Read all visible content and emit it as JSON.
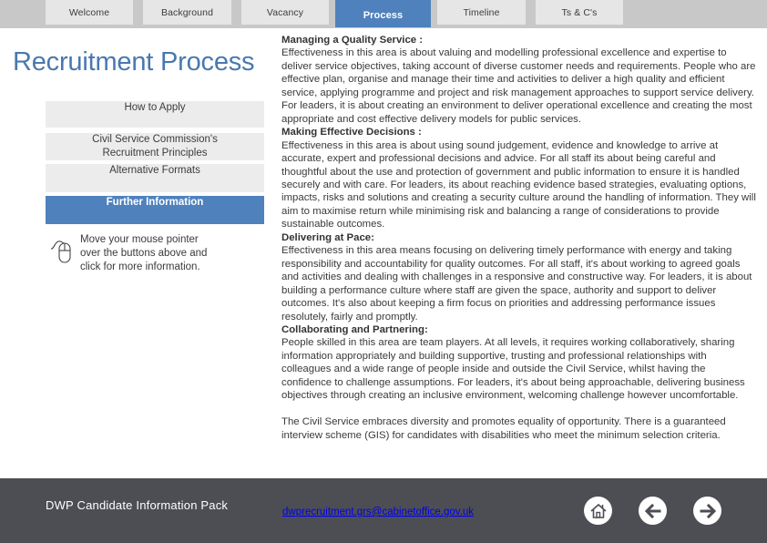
{
  "nav": {
    "tabs": [
      {
        "label": "Welcome",
        "active": false
      },
      {
        "label": "Background",
        "active": false
      },
      {
        "label": "Vacancy",
        "active": false
      },
      {
        "label": "Process",
        "active": true
      },
      {
        "label": "Timeline",
        "active": false
      },
      {
        "label": "Ts & C's",
        "active": false
      }
    ]
  },
  "page": {
    "title": "Recruitment Process"
  },
  "sidebar": {
    "buttons": [
      {
        "label": "How to Apply",
        "active": false
      },
      {
        "label": "Civil Service Commission's Recruitment Principles",
        "line1": "Civil Service Commission's",
        "line2": "Recruitment Principles",
        "active": false
      },
      {
        "label": "Alternative Formats",
        "active": false
      },
      {
        "label": "Further Information",
        "active": true
      }
    ],
    "hint": {
      "icon": "mouse-icon",
      "text": "Move your mouse pointer over the buttons above and click for more information.",
      "line1": "Move your mouse pointer",
      "line2": "over the buttons above and",
      "line3": "click for more information."
    }
  },
  "content": {
    "sections": [
      {
        "heading": "Managing a Quality Service :",
        "body": "Effectiveness in this area is about valuing and modelling professional excellence and expertise to deliver service objectives, taking account of diverse customer needs and requirements. People who are effective plan, organise and manage their time and activities to deliver a high quality and efficient service, applying programme and project and risk management approaches to support service delivery. For leaders, it is about creating an environment to deliver operational excellence and creating the most appropriate and cost effective delivery models for public services."
      },
      {
        "heading": "Making Effective Decisions :",
        "body": "Effectiveness in this area is about using sound judgement, evidence and knowledge to arrive at accurate, expert and professional decisions and advice. For all staff its about being careful and thoughtful about the use and protection of government and public information to ensure it is handled securely and with care. For leaders, its about reaching evidence based strategies, evaluating options, impacts, risks and solutions and creating a security culture around the handling of information. They will aim to maximise return while minimising risk and balancing a range of considerations to provide sustainable outcomes."
      },
      {
        "heading": "Delivering at Pace:",
        "body": "Effectiveness in this area means focusing on delivering timely performance with energy and taking responsibility and accountability for quality outcomes. For all staff, it's about working to agreed goals and activities and dealing with challenges in a responsive and constructive way. For leaders, it is about building a performance culture where staff are given the space, authority and support to deliver outcomes. It's also about keeping a firm focus on priorities and addressing performance issues resolutely, fairly and promptly."
      },
      {
        "heading": "Collaborating and Partnering:",
        "body": "People skilled in this area are team players. At all levels, it requires working collaboratively, sharing information appropriately and building supportive, trusting and professional relationships with colleagues and a wide range of people inside and outside the Civil Service, whilst having the confidence to challenge assumptions. For leaders, it's about being approachable, delivering business objectives through creating an inclusive environment, welcoming challenge however uncomfortable."
      }
    ],
    "closing": "The Civil Service embraces diversity and promotes equality of opportunity. There is a guaranteed interview scheme (GIS) for candidates with disabilities who meet the minimum selection criteria."
  },
  "footer": {
    "title": "DWP Candidate Information Pack",
    "email": "dwprecruitment.grs@cabinetoffice.gov.uk",
    "icons": {
      "home": "home-icon",
      "back": "arrow-left-icon",
      "forward": "arrow-right-icon"
    }
  },
  "colors": {
    "accent": "#4f81bd",
    "title": "#4a78ae",
    "nav_bg": "#c8c8c8",
    "tab_bg": "#e6e6e6",
    "footer_bg": "#4d4e54",
    "link": "#0000ee"
  }
}
